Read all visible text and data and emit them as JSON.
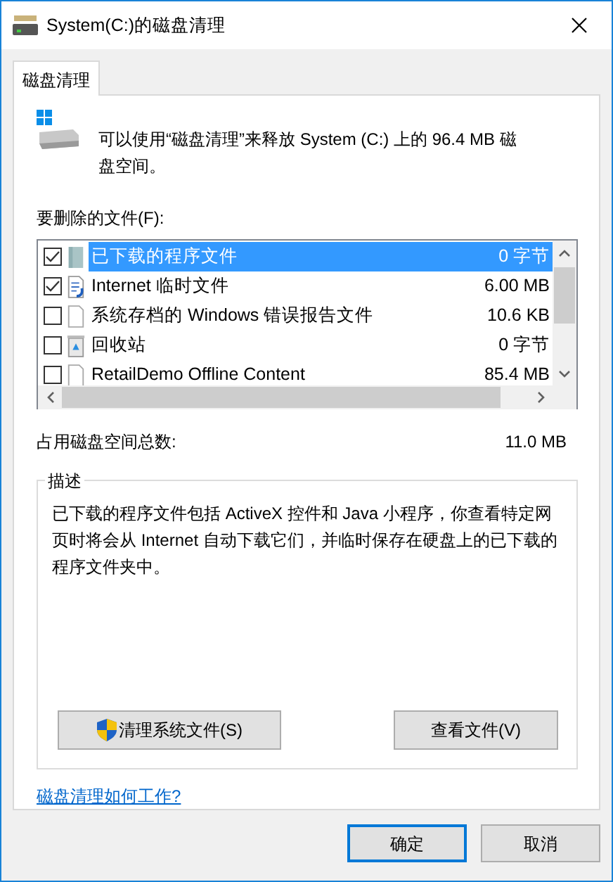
{
  "window": {
    "title": "System(C:)的磁盘清理"
  },
  "tabs": [
    {
      "label": "磁盘清理",
      "selected": true
    }
  ],
  "intro": "可以使用“磁盘清理”来释放 System (C:) 上的 96.4 MB 磁盘空间。",
  "files_label": "要删除的文件(F):",
  "files": [
    {
      "kind": "package",
      "name": "已下载的程序文件",
      "size": "0 字节",
      "checked": true,
      "selected": true
    },
    {
      "kind": "internet",
      "name": "Internet 临时文件",
      "size": "6.00 MB",
      "checked": true,
      "selected": false
    },
    {
      "kind": "document",
      "name": "系统存档的 Windows 错误报告文件",
      "size": "10.6 KB",
      "checked": false,
      "selected": false
    },
    {
      "kind": "recycle",
      "name": "回收站",
      "size": "0 字节",
      "checked": false,
      "selected": false
    },
    {
      "kind": "document",
      "name": "RetailDemo Offline Content",
      "size": "85.4 MB",
      "checked": false,
      "selected": false
    }
  ],
  "total": {
    "label": "占用磁盘空间总数:",
    "value": "11.0 MB"
  },
  "description": {
    "title": "描述",
    "text": "已下载的程序文件包括 ActiveX 控件和 Java 小程序，你查看特定网页时将会从 Internet 自动下载它们，并临时保存在硬盘上的已下载的程序文件夹中。"
  },
  "actions": [
    {
      "kind": "shield",
      "label": "清理系统文件(S)"
    },
    {
      "kind": "plain",
      "label": "查看文件(V)"
    }
  ],
  "link": "磁盘清理如何工作?",
  "dialog_buttons": [
    {
      "label": "确定",
      "default": true
    },
    {
      "label": "取消",
      "default": false
    }
  ]
}
